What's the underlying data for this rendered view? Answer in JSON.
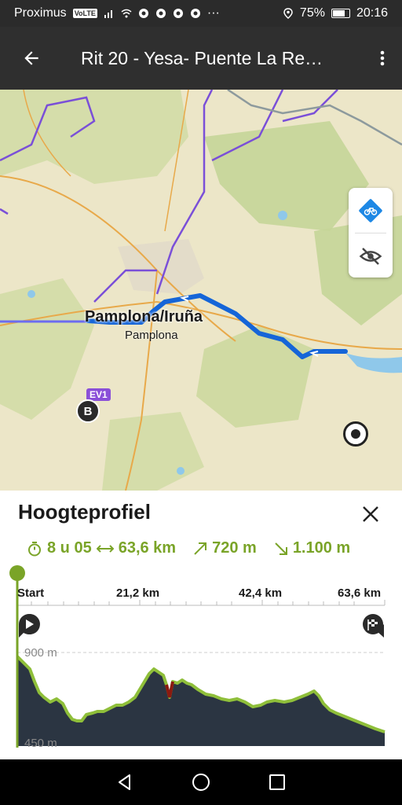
{
  "status_bar": {
    "carrier": "Proximus",
    "volte": "VoLTE",
    "battery": "75%",
    "time": "20:16",
    "icons": [
      "signal-icon",
      "wifi-icon",
      "chrome-icon",
      "location-icon",
      "battery-icon"
    ]
  },
  "app_bar": {
    "title": "Rit 20 - Yesa- Puente La Re…",
    "back_icon": "arrow-left-icon",
    "menu_icon": "more-vert-icon"
  },
  "map": {
    "city_label": "Pamplona/Iruña",
    "city_sub_label": "Pamplona",
    "route_badge": "EV1",
    "end_marker": "B",
    "controls": [
      "bike-icon",
      "eye-off-icon"
    ],
    "colors": {
      "route": "#1565d8",
      "land": "#ece6c8",
      "forest": "#c9d79a",
      "water": "#8fc8ea",
      "boundary": "#7a4fd8",
      "road": "#e8a94a"
    }
  },
  "elevation_panel": {
    "title": "Hoogteprofiel",
    "close_icon": "close-icon",
    "duration": "8 u 05",
    "distance": "63,6 km",
    "ascent": "720 m",
    "descent": "1.100 m",
    "accent_color": "#7aa428",
    "x_ticks": [
      "Start",
      "21,2 km",
      "42,4 km",
      "63,6 km"
    ],
    "y_ticks": [
      "900 m",
      "450 m"
    ],
    "start_flag_icon": "play-icon",
    "finish_flag_icon": "checkered-flag-icon"
  },
  "nav_bar": {
    "icons": [
      "back-triangle-icon",
      "home-circle-icon",
      "recents-square-icon"
    ]
  }
}
